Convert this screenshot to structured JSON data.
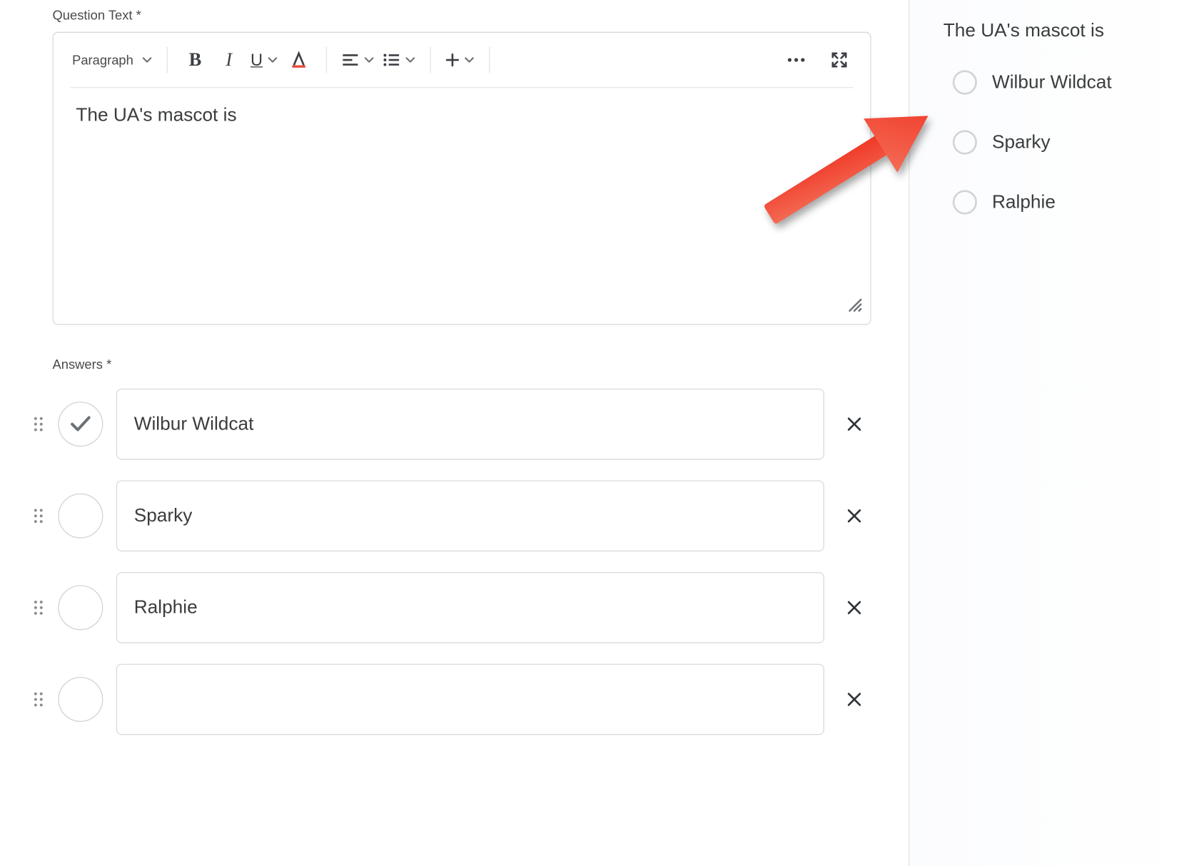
{
  "question": {
    "label": "Question Text *",
    "paragraph_style": "Paragraph",
    "text": "The UA's mascot is"
  },
  "answers": {
    "label": "Answers *",
    "items": [
      {
        "text": "Wilbur Wildcat",
        "correct": true
      },
      {
        "text": "Sparky",
        "correct": false
      },
      {
        "text": "Ralphie",
        "correct": false
      },
      {
        "text": "",
        "correct": false
      }
    ]
  },
  "preview": {
    "question": "The UA's mascot is",
    "options": [
      "Wilbur Wildcat",
      "Sparky",
      "Ralphie"
    ]
  }
}
